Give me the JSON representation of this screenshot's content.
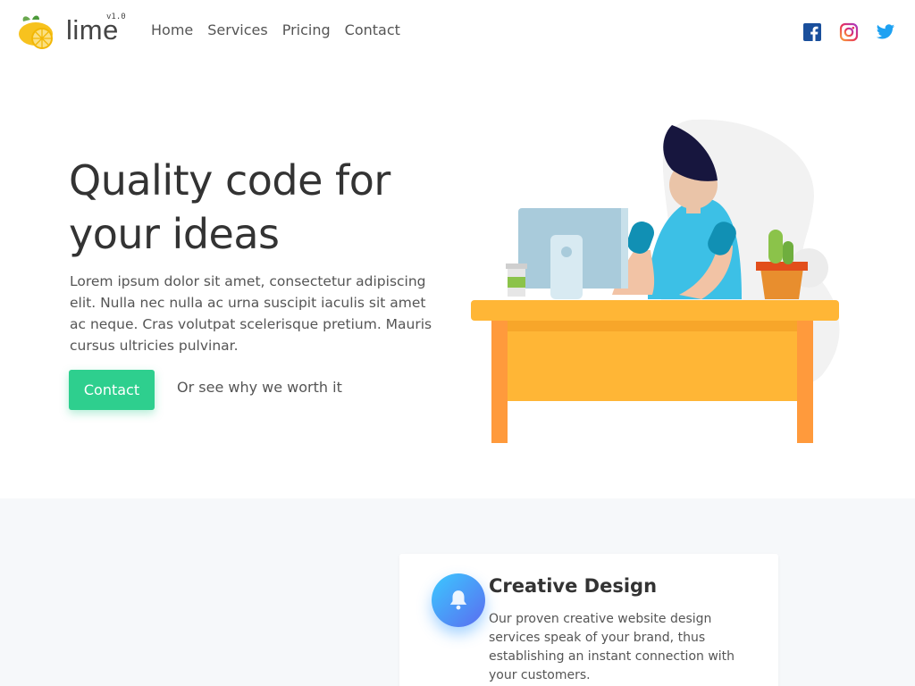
{
  "brand": {
    "name": "lime",
    "version": "v1.0",
    "icon": "lemon-logo-icon"
  },
  "nav": {
    "items": [
      {
        "label": "Home"
      },
      {
        "label": "Services"
      },
      {
        "label": "Pricing"
      },
      {
        "label": "Contact"
      }
    ],
    "social": [
      {
        "icon": "facebook-icon"
      },
      {
        "icon": "instagram-icon"
      },
      {
        "icon": "twitter-icon"
      }
    ]
  },
  "hero": {
    "title": "Quality code for your ideas",
    "description": "Lorem ipsum dolor sit amet, consectetur adipiscing elit. Nulla nec nulla ac urna suscipit iaculis sit amet ac neque. Cras volutpat scelerisque pretium. Mauris cursus ultricies pulvinar.",
    "primary_button": "Contact",
    "secondary_link": "Or see why we worth it"
  },
  "features": {
    "cards": [
      {
        "icon": "bell-icon",
        "title": "Creative Design",
        "description": "Our proven creative website design services speak of your brand, thus establishing an instant connection with your customers."
      }
    ]
  },
  "colors": {
    "accent": "#2ecf8e",
    "facebook": "#1a4f9c",
    "twitter": "#1da1f2",
    "desk": "#ffb636",
    "shirt": "#3cc0e6"
  }
}
